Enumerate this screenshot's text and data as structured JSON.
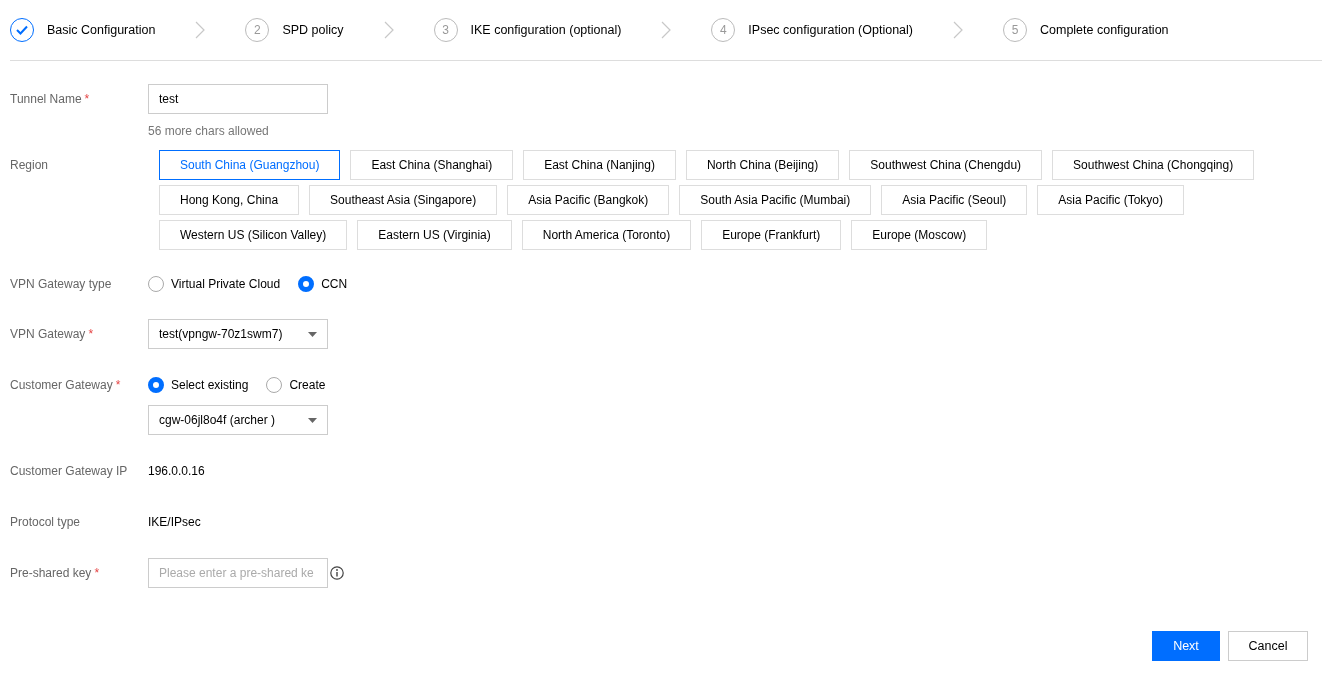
{
  "steps": [
    {
      "label": "Basic Configuration",
      "completed": true
    },
    {
      "number": "2",
      "label": "SPD policy",
      "completed": false
    },
    {
      "number": "3",
      "label": "IKE configuration (optional)",
      "completed": false
    },
    {
      "number": "4",
      "label": "IPsec configuration (Optional)",
      "completed": false
    },
    {
      "number": "5",
      "label": "Complete configuration",
      "completed": false
    }
  ],
  "tunnel_name": {
    "label": "Tunnel Name",
    "required_mark": "*",
    "value": "test",
    "hint": "56 more chars allowed"
  },
  "region": {
    "label": "Region",
    "rows": [
      [
        {
          "label": "South China (Guangzhou)",
          "selected": true
        },
        {
          "label": "East China (Shanghai)",
          "selected": false
        },
        {
          "label": "East China (Nanjing)",
          "selected": false
        },
        {
          "label": "North China (Beijing)",
          "selected": false
        },
        {
          "label": "Southwest China (Chengdu)",
          "selected": false
        },
        {
          "label": "Southwest China (Chongqing)",
          "selected": false
        }
      ],
      [
        {
          "label": "Hong Kong, China",
          "selected": false
        },
        {
          "label": "Southeast Asia (Singapore)",
          "selected": false
        },
        {
          "label": "Asia Pacific (Bangkok)",
          "selected": false
        },
        {
          "label": "South Asia Pacific (Mumbai)",
          "selected": false
        },
        {
          "label": "Asia Pacific (Seoul)",
          "selected": false
        },
        {
          "label": "Asia Pacific (Tokyo)",
          "selected": false
        }
      ],
      [
        {
          "label": "Western US (Silicon Valley)",
          "selected": false
        },
        {
          "label": "Eastern US (Virginia)",
          "selected": false
        },
        {
          "label": "North America (Toronto)",
          "selected": false
        },
        {
          "label": "Europe (Frankfurt)",
          "selected": false
        },
        {
          "label": "Europe (Moscow)",
          "selected": false
        }
      ]
    ]
  },
  "vpn_gateway_type": {
    "label": "VPN Gateway type",
    "options": [
      {
        "label": "Virtual Private Cloud",
        "selected": false
      },
      {
        "label": "CCN",
        "selected": true
      }
    ]
  },
  "vpn_gateway": {
    "label": "VPN Gateway",
    "required_mark": "*",
    "value": "test(vpngw-70z1swm7)"
  },
  "customer_gateway": {
    "label": "Customer Gateway",
    "required_mark": "*",
    "options": [
      {
        "label": "Select existing",
        "selected": true
      },
      {
        "label": "Create",
        "selected": false
      }
    ],
    "value": "cgw-06jl8o4f (archer )"
  },
  "customer_gateway_ip": {
    "label": "Customer Gateway IP",
    "value": "196.0.0.16"
  },
  "protocol_type": {
    "label": "Protocol type",
    "value": "IKE/IPsec"
  },
  "pre_shared_key": {
    "label": "Pre-shared key",
    "required_mark": "*",
    "placeholder": "Please enter a pre-shared ke"
  },
  "buttons": [
    {
      "label": "Next",
      "kind": "primary"
    },
    {
      "label": "Cancel",
      "kind": "secondary"
    }
  ]
}
